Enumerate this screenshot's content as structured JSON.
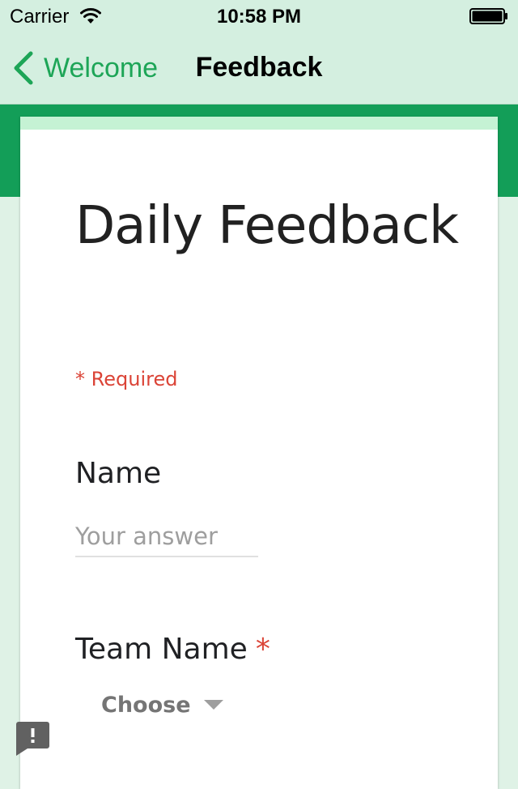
{
  "status_bar": {
    "carrier": "Carrier",
    "time": "10:58 PM",
    "icons": [
      "wifi-icon",
      "battery-icon"
    ]
  },
  "nav": {
    "back_label": "Welcome",
    "title": "Feedback",
    "accent_color": "#1da557"
  },
  "form": {
    "title": "Daily Feedback",
    "required_note": "* Required",
    "header_color": "#139e58",
    "questions": [
      {
        "label": "Name",
        "type": "text",
        "placeholder": "Your answer",
        "value": "",
        "required": false
      },
      {
        "label": "Team Name",
        "type": "dropdown",
        "required": true,
        "required_marker": "*",
        "selected": "Choose"
      }
    ]
  },
  "floating": {
    "icon": "report-icon",
    "glyph": "!"
  }
}
